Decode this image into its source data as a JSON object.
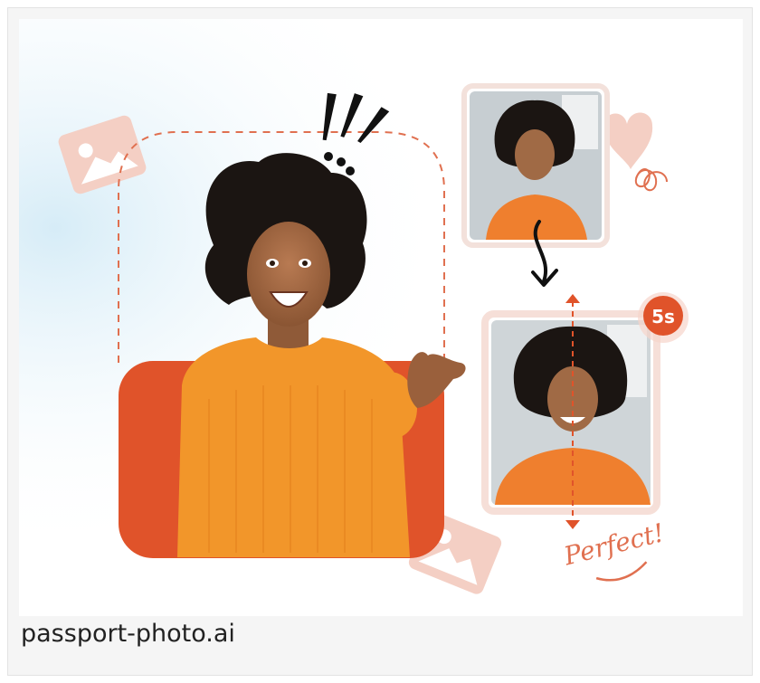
{
  "caption": {
    "source": "passport-photo.ai"
  },
  "illustration": {
    "timer_badge": "5s",
    "handwritten_note": "Perfect!",
    "exclamation": "!!!"
  },
  "colors": {
    "accent_orange": "#e0532a",
    "sweater_orange": "#f2962a",
    "dashed_line": "#e07050",
    "soft_pink": "#f4cfc4",
    "light_blue_glow": "#dcefff"
  },
  "icons": [
    "image-placeholder-icon",
    "heart-doodle-icon",
    "arrow-down-icon",
    "vertical-measure-icon"
  ]
}
